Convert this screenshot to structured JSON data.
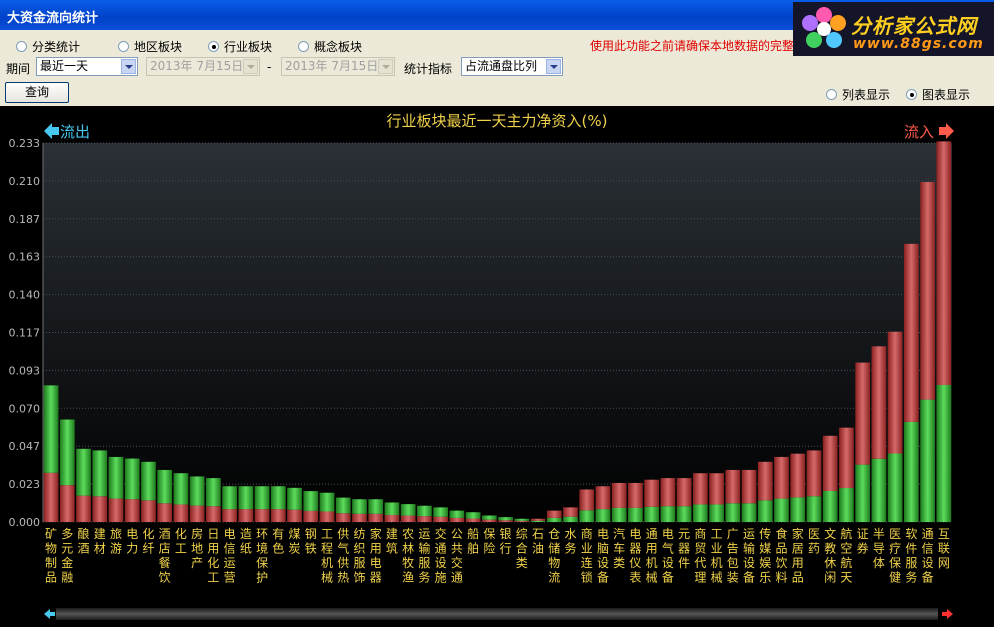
{
  "window": {
    "title": "大资金流向统计"
  },
  "logo": {
    "line1": "分析家公式网",
    "line2": "www.88gs.com"
  },
  "controls": {
    "categories": [
      {
        "label": "分类统计",
        "checked": false
      },
      {
        "label": "地区板块",
        "checked": false
      },
      {
        "label": "行业板块",
        "checked": true
      },
      {
        "label": "概念板块",
        "checked": false
      }
    ],
    "warning": "使用此功能之前请确保本地数据的完整",
    "period_label": "期间",
    "period_value": "最近一天",
    "date_from": "2013年  7月15日",
    "date_to": "2013年  7月15日",
    "date_dash": "-",
    "indicator_label": "统计指标",
    "indicator_value": "占流通盘比列",
    "query_button": "查询",
    "display_modes": [
      {
        "label": "列表显示",
        "checked": false
      },
      {
        "label": "图表显示",
        "checked": true
      }
    ]
  },
  "chart_data": {
    "type": "bar",
    "title": "行业板块最近一天主力净资入(%)",
    "outflow_label": "流出",
    "inflow_label": "流入",
    "ylim": [
      0,
      0.233
    ],
    "yticks": [
      "0.233",
      "0.210",
      "0.187",
      "0.163",
      "0.140",
      "0.117",
      "0.093",
      "0.070",
      "0.047",
      "0.023",
      "0.000"
    ],
    "categories": [
      "矿物制品",
      "多元金融",
      "酿酒",
      "建材",
      "旅游",
      "电力",
      "化纤",
      "酒店餐饮",
      "化工",
      "房地产",
      "日用化工",
      "电信运营",
      "造纸",
      "环境保护",
      "有色",
      "煤炭",
      "钢铁",
      "工程机械",
      "供气供热",
      "纺织服饰",
      "家用电器",
      "建筑",
      "农林牧渔",
      "运输服务",
      "交通设施",
      "公共交通",
      "船舶",
      "保险",
      "银行",
      "综合类",
      "石油",
      "仓储物流",
      "水务",
      "商业连锁",
      "电脑设备",
      "汽车类",
      "电器仪表",
      "通用机械",
      "电气设备",
      "元器件",
      "商贸代理",
      "工业机械",
      "广告包装",
      "运输设备",
      "传媒娱乐",
      "食品饮料",
      "家居用品",
      "医药",
      "文教休闲",
      "航空航天",
      "证券",
      "半导体",
      "医疗保健",
      "软件服务",
      "通信设备",
      "互联网"
    ],
    "direction": [
      "out",
      "out",
      "out",
      "out",
      "out",
      "out",
      "out",
      "out",
      "out",
      "out",
      "out",
      "out",
      "out",
      "out",
      "out",
      "out",
      "out",
      "out",
      "out",
      "out",
      "out",
      "out",
      "out",
      "out",
      "out",
      "out",
      "out",
      "out",
      "out",
      "out",
      "in",
      "in",
      "in",
      "in",
      "in",
      "in",
      "in",
      "in",
      "in",
      "in",
      "in",
      "in",
      "in",
      "in",
      "in",
      "in",
      "in",
      "in",
      "in",
      "in",
      "in",
      "in",
      "in",
      "in",
      "in",
      "in"
    ],
    "values": [
      0.084,
      0.063,
      0.045,
      0.044,
      0.04,
      0.039,
      0.037,
      0.032,
      0.03,
      0.028,
      0.027,
      0.022,
      0.022,
      0.022,
      0.022,
      0.021,
      0.019,
      0.018,
      0.015,
      0.014,
      0.014,
      0.012,
      0.011,
      0.01,
      0.009,
      0.007,
      0.006,
      0.004,
      0.003,
      0.002,
      0.002,
      0.007,
      0.009,
      0.02,
      0.022,
      0.024,
      0.024,
      0.026,
      0.027,
      0.027,
      0.03,
      0.03,
      0.032,
      0.032,
      0.037,
      0.04,
      0.042,
      0.044,
      0.053,
      0.058,
      0.098,
      0.108,
      0.117,
      0.171,
      0.209,
      0.234
    ]
  }
}
